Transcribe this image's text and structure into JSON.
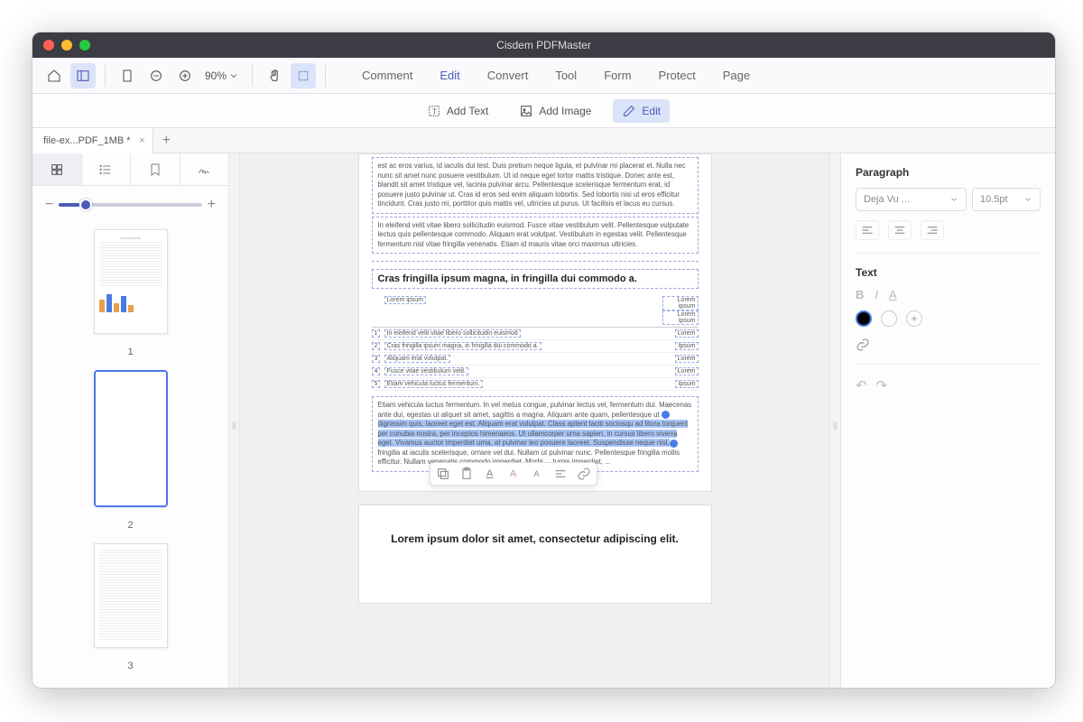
{
  "app_title": "Cisdem PDFMaster",
  "toolbar": {
    "zoom": "90%"
  },
  "menu": {
    "comment": "Comment",
    "edit": "Edit",
    "convert": "Convert",
    "tool": "Tool",
    "form": "Form",
    "protect": "Protect",
    "page": "Page"
  },
  "sub": {
    "add_text": "Add Text",
    "add_image": "Add Image",
    "edit": "Edit"
  },
  "filetab": {
    "name": "file-ex...PDF_1MB *"
  },
  "thumbs": {
    "n1": "1",
    "n2": "2",
    "n3": "3"
  },
  "doc": {
    "para1": "est ac eros varius, id iaculis dui test. Duis pretium neque ligula, et pulvinar mi placerat et. Nulla nec nunc sit amet nunc posuere vestibulum. Ut id neque eget tortor mattis tristique. Donec ante est, blandit sit amet tristique vel, lacinia pulvinar arcu. Pellentesque scelerisque fermentum erat, id posuere justo pulvinar ut. Cras id eros sed enim aliquam lobortis. Sed lobortis nisi ut eros efficitur tincidunt. Cras justo mi, porttitor quis mattis vel, ultricies ut purus. Ut facilisis et lacus eu cursus.",
    "para2": "In eleifend velit vitae libero sollicitudin euismod. Fusce vitae vestibulum velit. Pellentesque vulputate lectus quis pellentesque commodo. Aliquam erat volutpat. Vestibulum in egestas velit. Pellentesque fermentum nisl vitae fringilla venenatis. Etiam id mauris vitae orci maximus ultricies.",
    "heading": "Cras fringilla ipsum magna, in fringilla dui commodo a.",
    "table": {
      "h1": "Lorem ipsum",
      "h2": "Lorem ipsum",
      "h3": "Lorem ipsum",
      "r1n": "1",
      "r1a": "In eleifend velit vitae libero sollicitudin euismod",
      "r1b": "Lorem",
      "r2n": "2",
      "r2a": "Cras fringilla ipsum magna, in fringilla dui commodo a.",
      "r2b": "Ipsum",
      "r3n": "3",
      "r3a": "Aliquam erat volutpat.",
      "r3b": "Lorem",
      "r4n": "4",
      "r4a": "Fusce vitae vestibulum velit.",
      "r4b": "Lorem",
      "r5n": "5",
      "r5a": "Etiam vehicula luctus fermentum.",
      "r5b": "Ipsum"
    },
    "para3a": "Etiam vehicula luctus fermentum. In vel metus congue, pulvinar lectus vel, fermentum dui. Maecenas ante dui, egestas ut aliquet sit amet, sagittis a magna. Aliquam ante quam, pellentesque ut ",
    "para3b": "dignissim quis, laoreet eget est. Aliquam erat volutpat. Class aptent taciti sociosqu ad litora torquent per conubia nostra, per inceptos himenaeos. Ut ullamcorper urna sapien, in cursus libero viverra eget. Vivamus auctor imperdiet urna, at pulvinar leo posuere laoreet. Suspendisse neque nisl,",
    "para3c": " fringilla at iaculis scelerisque, ornare vel dui. Nullam ut pulvinar nunc. Pellentesque fringilla mollis efficitur. Nullam venenatis commodo imperdiet. Morbi ... turpis imperdiet, ...",
    "page3_heading": "Lorem ipsum dolor sit amet, consectetur adipiscing elit."
  },
  "panel": {
    "paragraph": "Paragraph",
    "text": "Text",
    "font": "Deja Vu ...",
    "size": "10.5pt",
    "bold": "B",
    "italic": "I",
    "underline": "A"
  }
}
